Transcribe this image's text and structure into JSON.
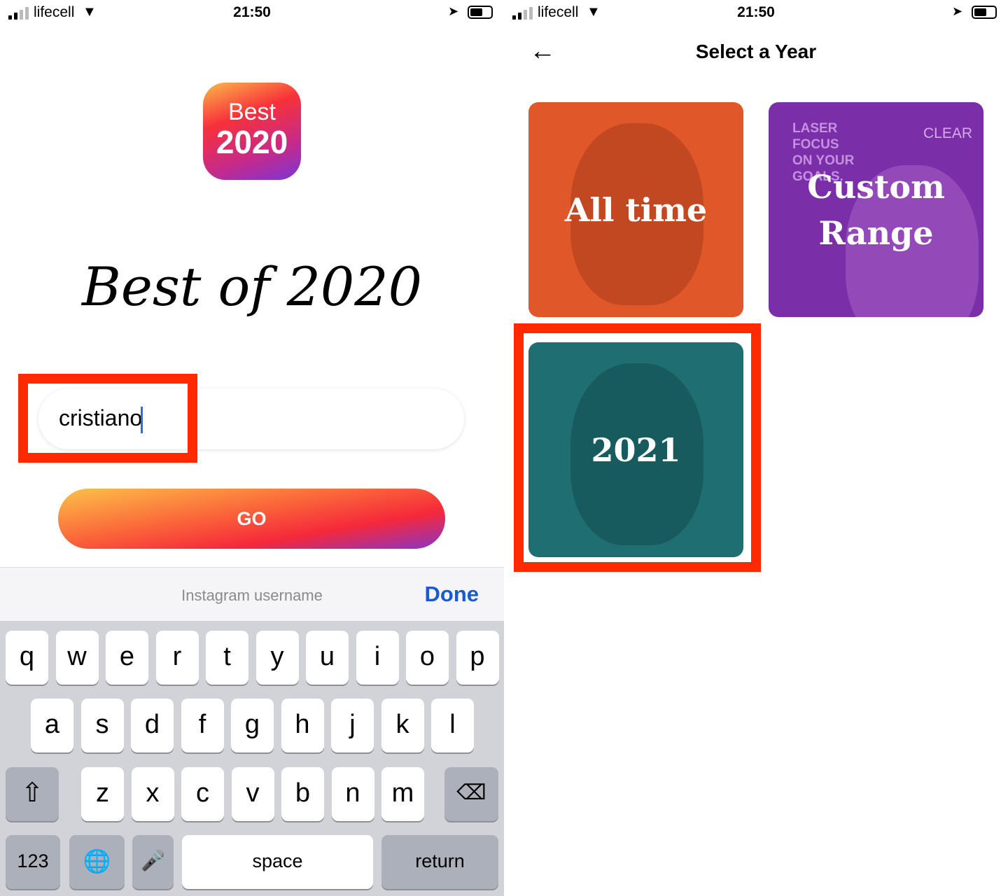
{
  "status_bar": {
    "carrier": "lifecell",
    "time": "21:50",
    "icons": [
      "signal-icon",
      "wifi-icon",
      "location-icon",
      "battery-icon"
    ]
  },
  "login": {
    "logo": {
      "line1": "Best",
      "line2": "2020"
    },
    "title": "Best of 2020",
    "username_value": "cristiano",
    "go_label": "GO",
    "keyboard_bar": {
      "hint": "Instagram username",
      "done_label": "Done"
    },
    "keyboard": {
      "row1": [
        "q",
        "w",
        "e",
        "r",
        "t",
        "y",
        "u",
        "i",
        "o",
        "p"
      ],
      "row2": [
        "a",
        "s",
        "d",
        "f",
        "g",
        "h",
        "j",
        "k",
        "l"
      ],
      "row3": [
        "z",
        "x",
        "c",
        "v",
        "b",
        "n",
        "m"
      ],
      "numbers": "123",
      "space": "space",
      "return": "return"
    },
    "highlight_color": "#ff2a00",
    "accent": "#1a5ad1"
  },
  "select_year": {
    "title": "Select a Year",
    "cards": [
      {
        "label": "All time",
        "color": "#e0582a"
      },
      {
        "label": "Custom Range",
        "color": "#7a2fa8",
        "bg_text": [
          "LASER",
          "FOCUS",
          "ON YOUR",
          "GOALS."
        ],
        "brand": "CLEAR"
      },
      {
        "label": "2021",
        "color": "#1e6e72"
      }
    ]
  }
}
